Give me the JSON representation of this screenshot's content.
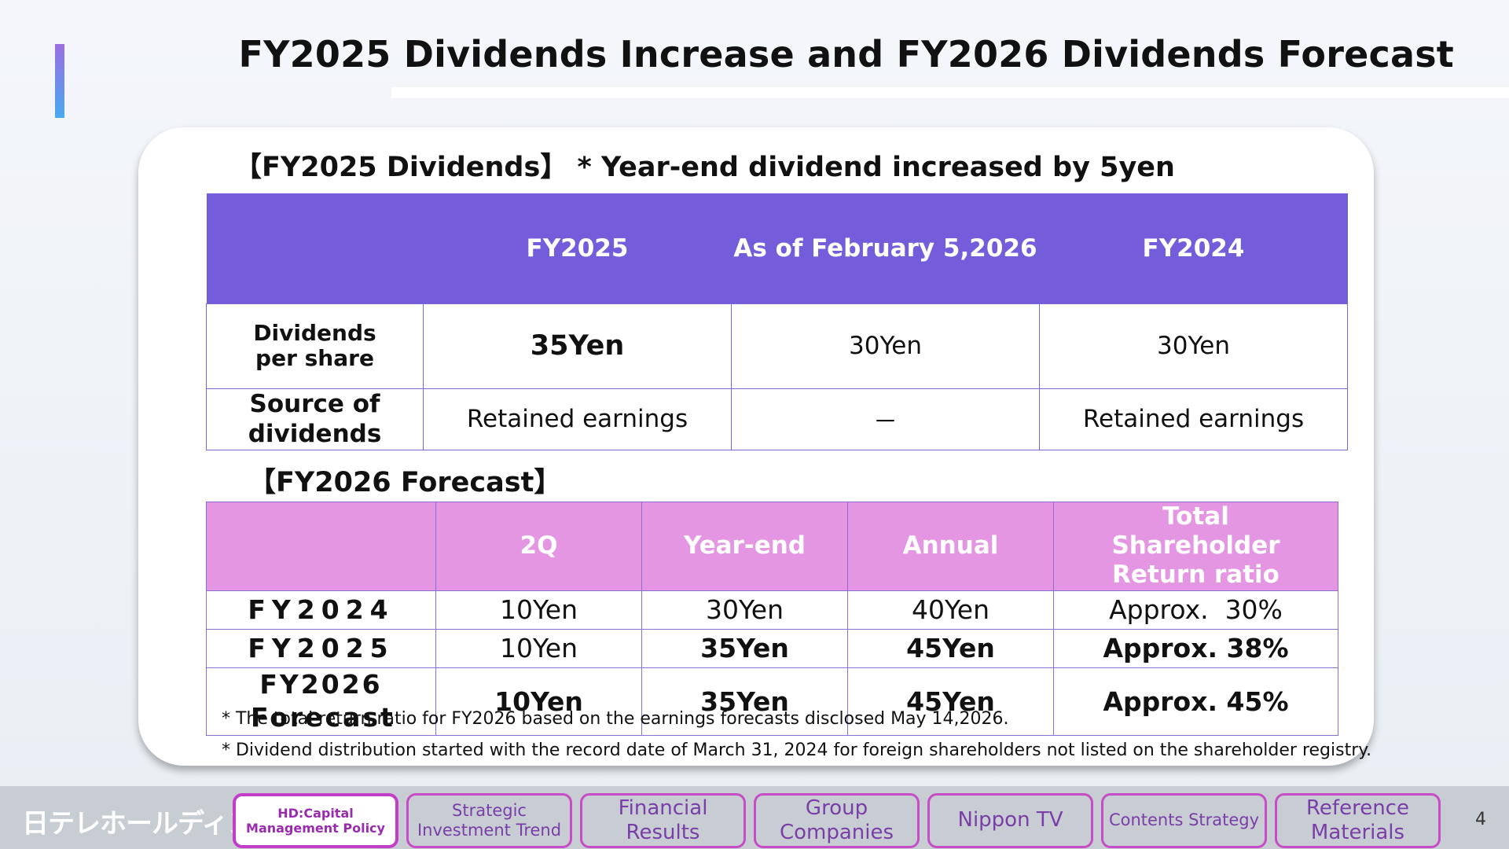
{
  "title": "FY2025 Dividends Increase and FY2026 Dividends Forecast",
  "section1": {
    "heading": "【FY2025 Dividends】 * Year-end dividend increased by 5yen",
    "columns": [
      "",
      "FY2025",
      "As of February 5,2026",
      "FY2024"
    ],
    "rows": [
      {
        "label": "Dividends per share",
        "values": [
          "35Yen",
          "30Yen",
          "30Yen"
        ]
      },
      {
        "label": "Source of dividends",
        "values": [
          "Retained earnings",
          "－",
          "Retained earnings"
        ]
      }
    ]
  },
  "section2": {
    "heading": "【FY2026 Forecast】",
    "columns": [
      "",
      "2Q",
      "Year-end",
      "Annual",
      "Total Shareholder Return ratio"
    ],
    "rows": [
      {
        "label": "FY2024",
        "values": [
          "10Yen",
          "30Yen",
          "40Yen",
          "Approx.  30%"
        ]
      },
      {
        "label": "FY2025",
        "values": [
          "10Yen",
          "35Yen",
          "45Yen",
          "Approx. 38%"
        ]
      },
      {
        "label": "FY2026 Forecast",
        "values": [
          "10Yen",
          "35Yen",
          "45Yen",
          "Approx. 45%"
        ]
      }
    ]
  },
  "notes": [
    "* The total return ratio for FY2026 based on the earnings forecasts disclosed May 14,2026.",
    "* Dividend distribution started with the record date of March 31, 2024 for foreign shareholders not listed on the shareholder registry."
  ],
  "footer": {
    "logo": "日テレホールディングス",
    "nav": [
      {
        "label": "HD:Capital Management  Policy",
        "active": true
      },
      {
        "label": "Strategic Investment Trend",
        "active": false
      },
      {
        "label": "Financial Results",
        "active": false
      },
      {
        "label": "Group Companies",
        "active": false
      },
      {
        "label": "Nippon TV",
        "active": false
      },
      {
        "label": "Contents Strategy",
        "active": false
      },
      {
        "label": "Reference Materials",
        "active": false
      }
    ],
    "page_number": "4"
  },
  "colors": {
    "table1_header": "#755cdb",
    "table2_header": "#e496e2",
    "nav_border": "#c64dc6"
  }
}
